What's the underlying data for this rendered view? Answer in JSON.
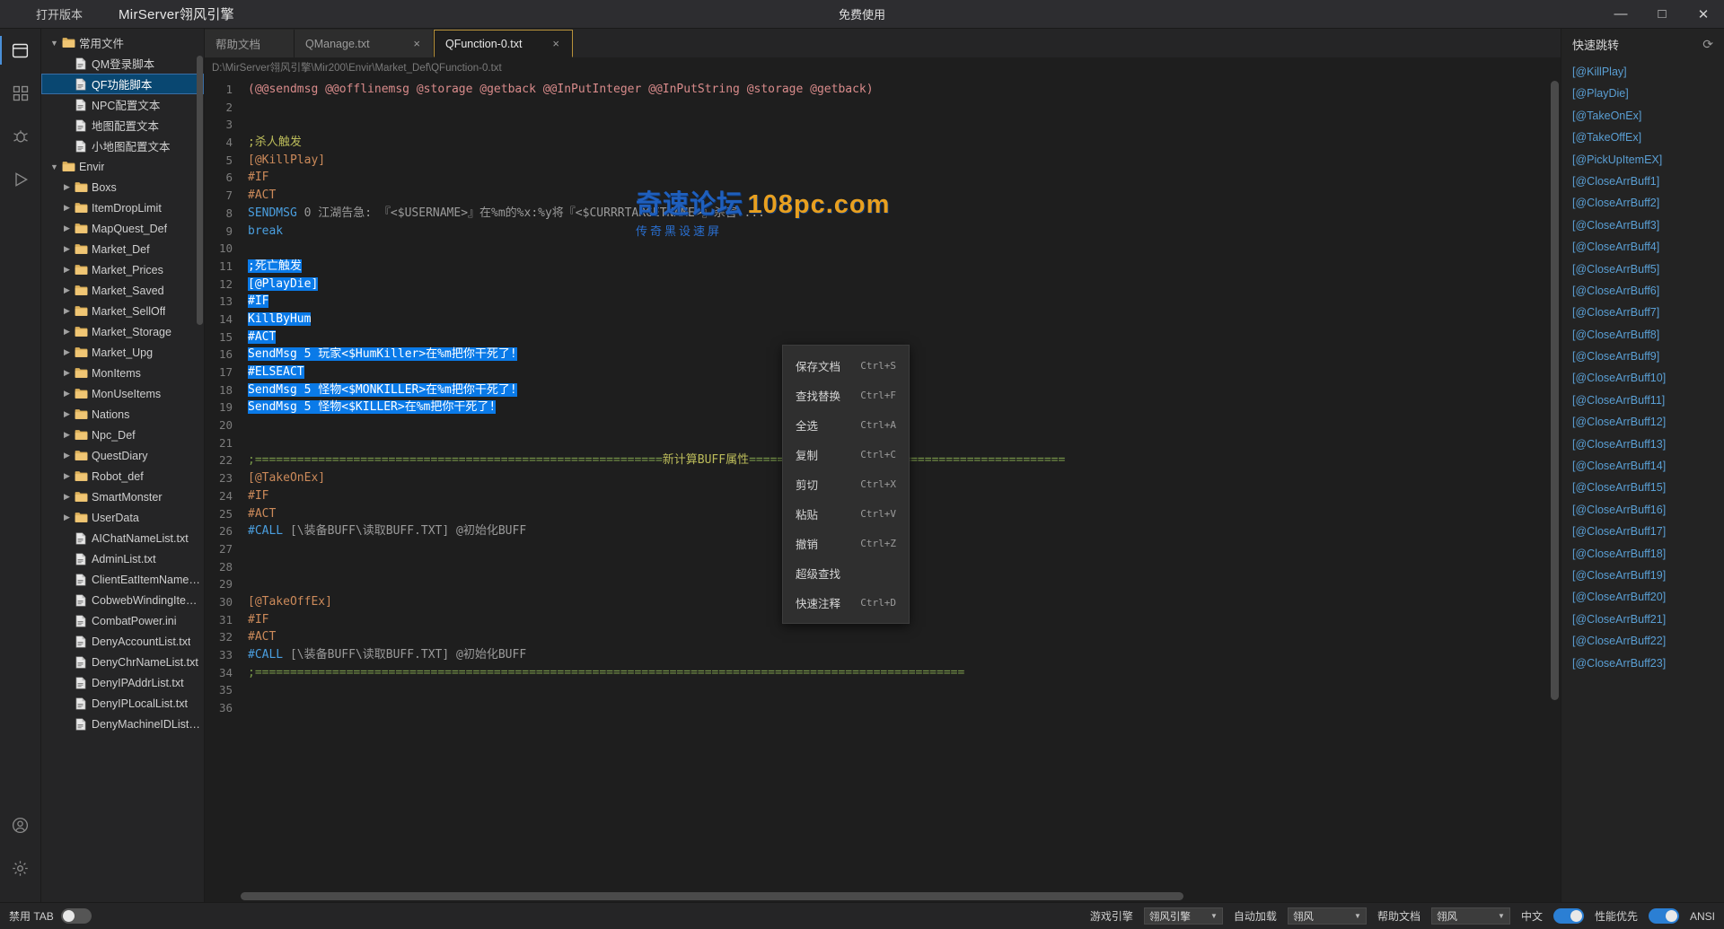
{
  "titlebar": {
    "open_version": "打开版本",
    "app_title": "MirServer翎风引擎",
    "center_text": "免费使用",
    "minimize": "—",
    "maximize": "□",
    "close": "✕"
  },
  "activitybar": {
    "items": [
      {
        "name": "explorer",
        "glyph": "files"
      },
      {
        "name": "extensions",
        "glyph": "grid"
      },
      {
        "name": "debug",
        "glyph": "bug"
      },
      {
        "name": "run",
        "glyph": "play"
      },
      {
        "name": "account",
        "glyph": "person"
      },
      {
        "name": "settings",
        "glyph": "gear"
      }
    ]
  },
  "sidebar": {
    "items": [
      {
        "label": "常用文件",
        "depth": 0,
        "kind": "folder",
        "twisty": "▼",
        "selected": false
      },
      {
        "label": "QM登录脚本",
        "depth": 1,
        "kind": "file",
        "twisty": "",
        "selected": false
      },
      {
        "label": "QF功能脚本",
        "depth": 1,
        "kind": "file",
        "twisty": "",
        "selected": true
      },
      {
        "label": "NPC配置文本",
        "depth": 1,
        "kind": "file",
        "twisty": "",
        "selected": false
      },
      {
        "label": "地图配置文本",
        "depth": 1,
        "kind": "file",
        "twisty": "",
        "selected": false
      },
      {
        "label": "小地图配置文本",
        "depth": 1,
        "kind": "file",
        "twisty": "",
        "selected": false
      },
      {
        "label": "Envir",
        "depth": 0,
        "kind": "folder",
        "twisty": "▼",
        "selected": false
      },
      {
        "label": "Boxs",
        "depth": 1,
        "kind": "folder",
        "twisty": "▶",
        "selected": false
      },
      {
        "label": "ItemDropLimit",
        "depth": 1,
        "kind": "folder",
        "twisty": "▶",
        "selected": false
      },
      {
        "label": "MapQuest_Def",
        "depth": 1,
        "kind": "folder",
        "twisty": "▶",
        "selected": false
      },
      {
        "label": "Market_Def",
        "depth": 1,
        "kind": "folder",
        "twisty": "▶",
        "selected": false
      },
      {
        "label": "Market_Prices",
        "depth": 1,
        "kind": "folder",
        "twisty": "▶",
        "selected": false
      },
      {
        "label": "Market_Saved",
        "depth": 1,
        "kind": "folder",
        "twisty": "▶",
        "selected": false
      },
      {
        "label": "Market_SellOff",
        "depth": 1,
        "kind": "folder",
        "twisty": "▶",
        "selected": false
      },
      {
        "label": "Market_Storage",
        "depth": 1,
        "kind": "folder",
        "twisty": "▶",
        "selected": false
      },
      {
        "label": "Market_Upg",
        "depth": 1,
        "kind": "folder",
        "twisty": "▶",
        "selected": false
      },
      {
        "label": "MonItems",
        "depth": 1,
        "kind": "folder",
        "twisty": "▶",
        "selected": false
      },
      {
        "label": "MonUseItems",
        "depth": 1,
        "kind": "folder",
        "twisty": "▶",
        "selected": false
      },
      {
        "label": "Nations",
        "depth": 1,
        "kind": "folder",
        "twisty": "▶",
        "selected": false
      },
      {
        "label": "Npc_Def",
        "depth": 1,
        "kind": "folder",
        "twisty": "▶",
        "selected": false
      },
      {
        "label": "QuestDiary",
        "depth": 1,
        "kind": "folder",
        "twisty": "▶",
        "selected": false
      },
      {
        "label": "Robot_def",
        "depth": 1,
        "kind": "folder",
        "twisty": "▶",
        "selected": false
      },
      {
        "label": "SmartMonster",
        "depth": 1,
        "kind": "folder",
        "twisty": "▶",
        "selected": false
      },
      {
        "label": "UserData",
        "depth": 1,
        "kind": "folder",
        "twisty": "▶",
        "selected": false
      },
      {
        "label": "AIChatNameList.txt",
        "depth": 1,
        "kind": "file",
        "twisty": "",
        "selected": false
      },
      {
        "label": "AdminList.txt",
        "depth": 1,
        "kind": "file",
        "twisty": "",
        "selected": false
      },
      {
        "label": "ClientEatItemNameList.t",
        "depth": 1,
        "kind": "file",
        "twisty": "",
        "selected": false
      },
      {
        "label": "CobwebWindingItemList.t",
        "depth": 1,
        "kind": "file",
        "twisty": "",
        "selected": false
      },
      {
        "label": "CombatPower.ini",
        "depth": 1,
        "kind": "file",
        "twisty": "",
        "selected": false
      },
      {
        "label": "DenyAccountList.txt",
        "depth": 1,
        "kind": "file",
        "twisty": "",
        "selected": false
      },
      {
        "label": "DenyChrNameList.txt",
        "depth": 1,
        "kind": "file",
        "twisty": "",
        "selected": false
      },
      {
        "label": "DenyIPAddrList.txt",
        "depth": 1,
        "kind": "file",
        "twisty": "",
        "selected": false
      },
      {
        "label": "DenyIPLocalList.txt",
        "depth": 1,
        "kind": "file",
        "twisty": "",
        "selected": false
      },
      {
        "label": "DenyMachineIDList.txt",
        "depth": 1,
        "kind": "file",
        "twisty": "",
        "selected": false
      }
    ]
  },
  "tabs": [
    {
      "label": "帮助文档",
      "closable": false,
      "active": false
    },
    {
      "label": "QManage.txt",
      "closable": true,
      "active": false
    },
    {
      "label": "QFunction-0.txt",
      "closable": true,
      "active": true
    }
  ],
  "tab_close_glyph": "×",
  "path": "D:\\MirServer翎风引擎\\Mir200\\Envir\\Market_Def\\QFunction-0.txt",
  "editor": {
    "total_lines": 36,
    "lines": [
      {
        "n": 1,
        "segs": [
          {
            "t": "(@@sendmsg @@offlinemsg @storage @getback @@InPutInteger @@InPutString @storage @getback)",
            "c": "c-pink"
          }
        ]
      },
      {
        "n": 2,
        "segs": []
      },
      {
        "n": 3,
        "segs": []
      },
      {
        "n": 4,
        "segs": [
          {
            "t": ";杀人触发",
            "c": "c-yellow"
          }
        ]
      },
      {
        "n": 5,
        "segs": [
          {
            "t": "[@KillPlay]",
            "c": "c-orange"
          }
        ]
      },
      {
        "n": 6,
        "segs": [
          {
            "t": "#IF",
            "c": "c-orange"
          }
        ]
      },
      {
        "n": 7,
        "segs": [
          {
            "t": "#ACT",
            "c": "c-orange"
          }
        ]
      },
      {
        "n": 8,
        "segs": [
          {
            "t": "SENDMSG",
            "c": "c-blue"
          },
          {
            "t": " 0 江湖告急: 『<$USERNAME>』在%m的%x:%y将『<$CURRRTARGETNAME>』杀害....",
            "c": "c-gray"
          }
        ]
      },
      {
        "n": 9,
        "segs": [
          {
            "t": "break",
            "c": "c-blue"
          }
        ]
      },
      {
        "n": 10,
        "segs": []
      },
      {
        "n": 11,
        "segs": [
          {
            "t": ";死亡触发",
            "c": "sel"
          }
        ]
      },
      {
        "n": 12,
        "segs": [
          {
            "t": "[@PlayDie]",
            "c": "sel"
          }
        ]
      },
      {
        "n": 13,
        "segs": [
          {
            "t": "#IF",
            "c": "sel"
          }
        ]
      },
      {
        "n": 14,
        "segs": [
          {
            "t": "KillByHum",
            "c": "sel"
          }
        ]
      },
      {
        "n": 15,
        "segs": [
          {
            "t": "#ACT",
            "c": "sel"
          }
        ]
      },
      {
        "n": 16,
        "segs": [
          {
            "t": "SendMsg 5 玩家<$HumKiller>在%m把你干死了!",
            "c": "sel"
          }
        ]
      },
      {
        "n": 17,
        "segs": [
          {
            "t": "#ELSEACT",
            "c": "sel"
          }
        ]
      },
      {
        "n": 18,
        "segs": [
          {
            "t": "SendMsg 5 怪物<$MONKILLER>在%m把你干死了!",
            "c": "sel"
          }
        ]
      },
      {
        "n": 19,
        "segs": [
          {
            "t": "SendMsg 5 怪物<$KILLER>在%m把你干死了!",
            "c": "sel"
          }
        ]
      },
      {
        "n": 20,
        "segs": []
      },
      {
        "n": 21,
        "segs": []
      },
      {
        "n": 22,
        "segs": [
          {
            "t": ";==========================================================",
            "c": "c-green"
          },
          {
            "t": "新计算BUFF属性",
            "c": "c-yellow"
          },
          {
            "t": "=============================================",
            "c": "c-green"
          }
        ]
      },
      {
        "n": 23,
        "segs": [
          {
            "t": "[@TakeOnEx]",
            "c": "c-orange"
          }
        ]
      },
      {
        "n": 24,
        "segs": [
          {
            "t": "#IF",
            "c": "c-orange"
          }
        ]
      },
      {
        "n": 25,
        "segs": [
          {
            "t": "#ACT",
            "c": "c-orange"
          }
        ]
      },
      {
        "n": 26,
        "segs": [
          {
            "t": "#CALL",
            "c": "c-blue"
          },
          {
            "t": " [\\装备BUFF\\读取BUFF.TXT] @初始化BUFF",
            "c": "c-gray"
          }
        ]
      },
      {
        "n": 27,
        "segs": []
      },
      {
        "n": 28,
        "segs": []
      },
      {
        "n": 29,
        "segs": []
      },
      {
        "n": 30,
        "segs": [
          {
            "t": "[@TakeOffEx]",
            "c": "c-orange"
          }
        ]
      },
      {
        "n": 31,
        "segs": [
          {
            "t": "#IF",
            "c": "c-orange"
          }
        ]
      },
      {
        "n": 32,
        "segs": [
          {
            "t": "#ACT",
            "c": "c-orange"
          }
        ]
      },
      {
        "n": 33,
        "segs": [
          {
            "t": "#CALL",
            "c": "c-blue"
          },
          {
            "t": " [\\装备BUFF\\读取BUFF.TXT] @初始化BUFF",
            "c": "c-gray"
          }
        ]
      },
      {
        "n": 34,
        "segs": [
          {
            "t": ";=====================================================================================================",
            "c": "c-green"
          }
        ]
      },
      {
        "n": 35,
        "segs": []
      },
      {
        "n": 36,
        "segs": []
      }
    ]
  },
  "watermark": {
    "main_left": "奇速论坛",
    "main_right": "108pc.com",
    "sub": "传奇黑设速屏"
  },
  "context_menu": {
    "items": [
      {
        "label": "保存文档",
        "shortcut": "Ctrl+S"
      },
      {
        "label": "查找替换",
        "shortcut": "Ctrl+F"
      },
      {
        "label": "全选",
        "shortcut": "Ctrl+A"
      },
      {
        "label": "复制",
        "shortcut": "Ctrl+C"
      },
      {
        "label": "剪切",
        "shortcut": "Ctrl+X"
      },
      {
        "label": "粘贴",
        "shortcut": "Ctrl+V"
      },
      {
        "label": "撤销",
        "shortcut": "Ctrl+Z"
      },
      {
        "label": "超级查找",
        "shortcut": ""
      },
      {
        "label": "快速注释",
        "shortcut": "Ctrl+D"
      }
    ]
  },
  "rightpanel": {
    "title": "快速跳转",
    "refresh_glyph": "⟳",
    "items": [
      {
        "label": "[@KillPlay]"
      },
      {
        "label": "[@PlayDie]"
      },
      {
        "label": "[@TakeOnEx]"
      },
      {
        "label": "[@TakeOffEx]"
      },
      {
        "label": "[@PickUpItemEX]"
      },
      {
        "label": "[@CloseArrBuff1]"
      },
      {
        "label": "[@CloseArrBuff2]"
      },
      {
        "label": "[@CloseArrBuff3]"
      },
      {
        "label": "[@CloseArrBuff4]"
      },
      {
        "label": "[@CloseArrBuff5]"
      },
      {
        "label": "[@CloseArrBuff6]"
      },
      {
        "label": "[@CloseArrBuff7]"
      },
      {
        "label": "[@CloseArrBuff8]"
      },
      {
        "label": "[@CloseArrBuff9]"
      },
      {
        "label": "[@CloseArrBuff10]"
      },
      {
        "label": "[@CloseArrBuff11]"
      },
      {
        "label": "[@CloseArrBuff12]"
      },
      {
        "label": "[@CloseArrBuff13]"
      },
      {
        "label": "[@CloseArrBuff14]"
      },
      {
        "label": "[@CloseArrBuff15]"
      },
      {
        "label": "[@CloseArrBuff16]"
      },
      {
        "label": "[@CloseArrBuff17]"
      },
      {
        "label": "[@CloseArrBuff18]"
      },
      {
        "label": "[@CloseArrBuff19]"
      },
      {
        "label": "[@CloseArrBuff20]"
      },
      {
        "label": "[@CloseArrBuff21]"
      },
      {
        "label": "[@CloseArrBuff22]"
      },
      {
        "label": "[@CloseArrBuff23]"
      }
    ]
  },
  "statusbar": {
    "disable_tab_label": "禁用 TAB",
    "disable_tab_on": false,
    "game_engine_label": "游戏引擎",
    "game_engine_value": "翎风引擎",
    "autoload_label": "自动加载",
    "autoload_value": "翎风",
    "helpdoc_label": "帮助文档",
    "helpdoc_value": "翎风",
    "chinese_label": "中文",
    "chinese_on": true,
    "perf_label": "性能优先",
    "perf_on": true,
    "encoding": "ANSI",
    "chevron": "▼"
  },
  "colors": {
    "accent_blue": "#0a7ae8",
    "tab_active_border": "#b8923a",
    "selection_bg": "#0a7ae8",
    "sidebar_selected": "#094771",
    "toggle_on": "#2b7fd4"
  }
}
